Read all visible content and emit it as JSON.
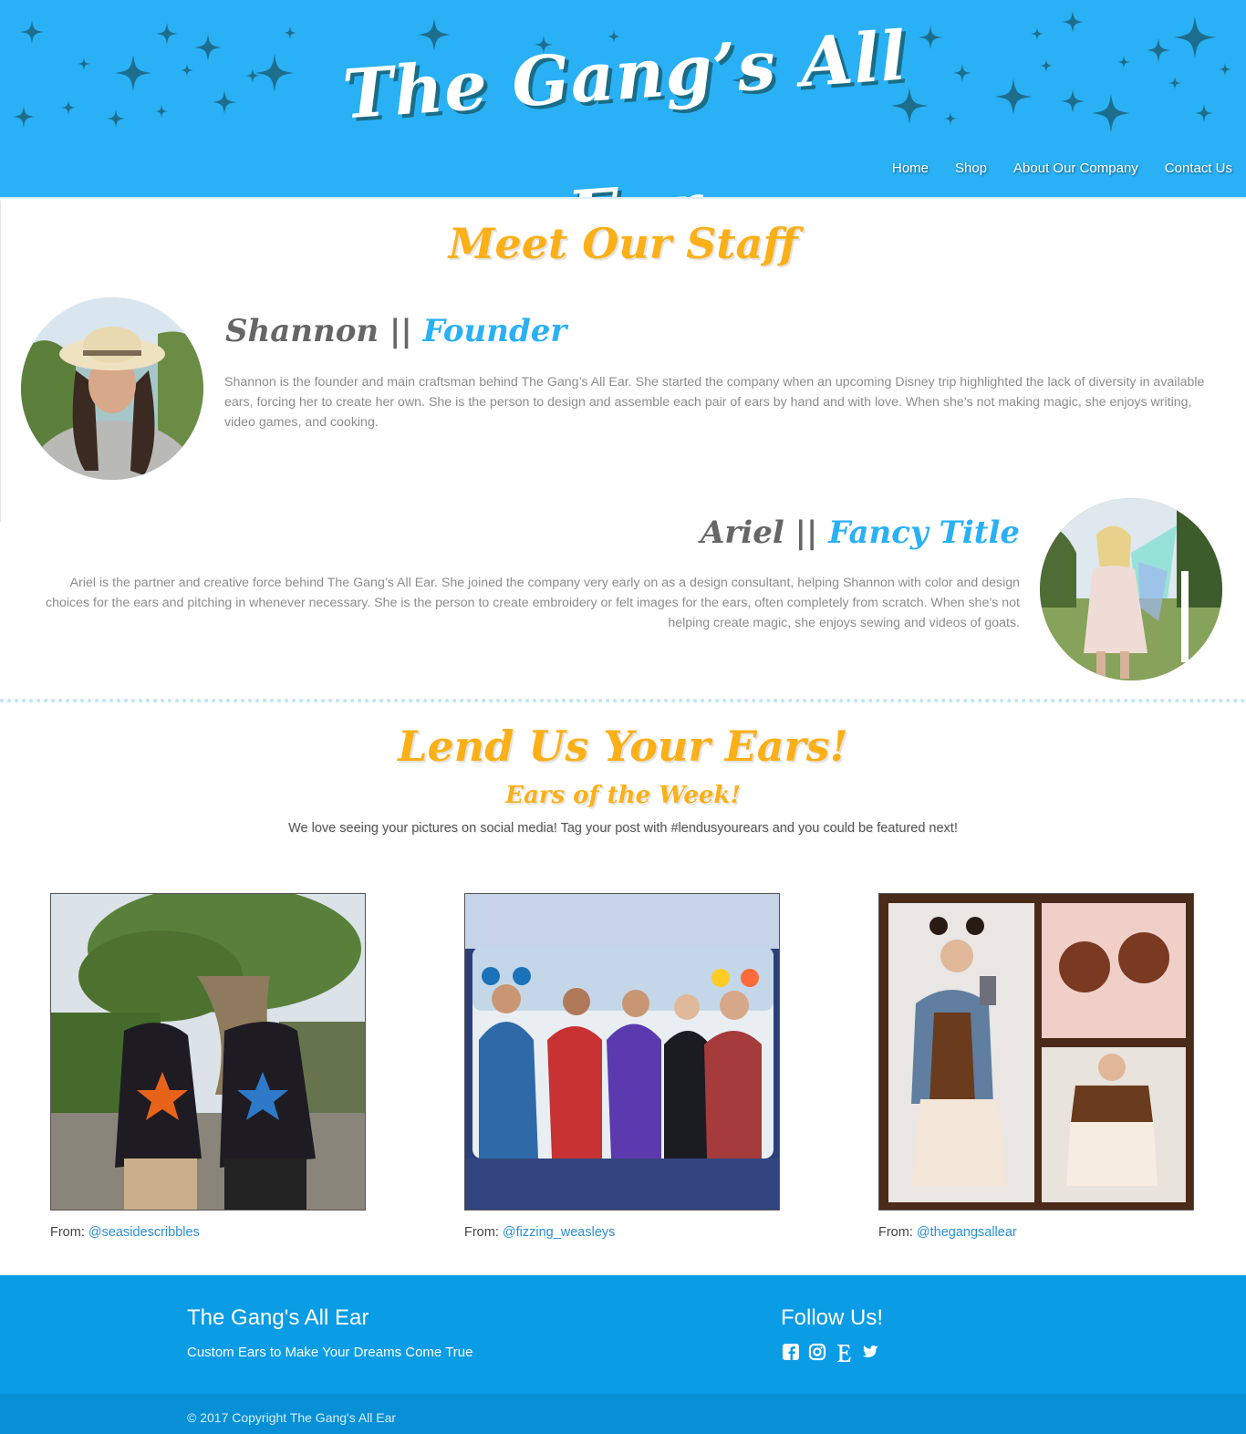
{
  "header": {
    "logo_text": "The Gang’s All Ear",
    "nav": [
      "Home",
      "Shop",
      "About Our Company",
      "Contact Us"
    ],
    "background_color": "#2ab0f5"
  },
  "staff": {
    "title": "Meet Our Staff",
    "members": [
      {
        "name": "Shannon",
        "separator": "||",
        "role": "Founder",
        "bio": "Shannon is the founder and main craftsman behind The Gang’s All Ear. She started the company when an upcoming Disney trip highlighted the lack of diversity in available ears, forcing her to create her own. She is the person to design and assemble each pair of ears by hand and with love. When she’s not making magic, she enjoys writing, video games, and cooking."
      },
      {
        "name": "Ariel",
        "separator": "||",
        "role": "Fancy Title",
        "bio": "Ariel is the partner and creative force behind The Gang’s All Ear. She joined the company very early on as a design consultant, helping Shannon with color and design choices for the ears and pitching in whenever necessary. She is the person to create embroidery or felt images for the ears, often completely from scratch. When she’s not helping create magic, she enjoys sewing and videos of goats."
      }
    ]
  },
  "ears": {
    "title": "Lend Us Your Ears!",
    "subtitle": "Ears of the Week!",
    "text": "We love seeing your pictures on social media! Tag your post with #lendusyourears and you could be featured next!",
    "photos": [
      {
        "from_label": "From:",
        "handle": "@seasidescribbles"
      },
      {
        "from_label": "From:",
        "handle": "@fizzing_weasleys"
      },
      {
        "from_label": "From:",
        "handle": "@thegangsallear"
      }
    ]
  },
  "footer": {
    "title": "The Gang's All Ear",
    "tagline": "Custom Ears to Make Your Dreams Come True",
    "follow_title": "Follow Us!",
    "social_icons": [
      "facebook-icon",
      "instagram-icon",
      "etsy-icon",
      "twitter-icon"
    ],
    "copyright": "© 2017 Copyright The Gang's All Ear"
  },
  "colors": {
    "accent_orange": "#fbb017",
    "accent_blue": "#2ab0f5",
    "footer_blue": "#0a9ce4"
  }
}
